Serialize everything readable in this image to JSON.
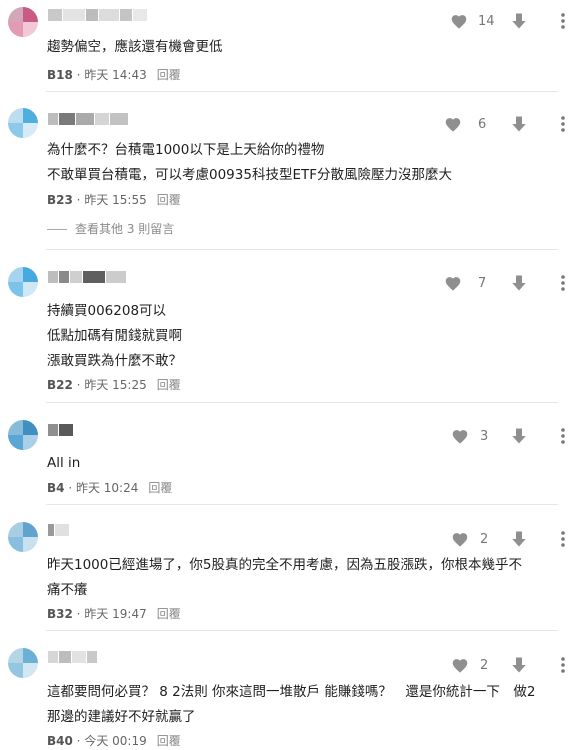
{
  "colors": {
    "heart": "#8f8f8f",
    "text": "#1f1f1f",
    "meta": "#666666"
  },
  "icons": {
    "like": "heart-icon",
    "dislike": "arrow-down-icon",
    "more": "more-vertical-icon"
  },
  "comments": [
    {
      "likes": "14",
      "lines": [
        "趨勢偏空，應該還有機會更低"
      ],
      "floor": "B18",
      "time": "昨天 14:43",
      "reply": "回覆"
    },
    {
      "likes": "6",
      "lines": [
        "為什麼不？台積電1000以下是上天給你的禮物",
        "不敢單買台積電，可以考慮00935科技型ETF分散風險壓力沒那麼大"
      ],
      "floor": "B23",
      "time": "昨天 15:55",
      "reply": "回覆",
      "more_replies": "查看其他 3 則留言"
    },
    {
      "likes": "7",
      "lines": [
        "持續買006208可以",
        "低點加碼有閒錢就買啊",
        "漲敢買跌為什麼不敢？"
      ],
      "floor": "B22",
      "time": "昨天 15:25",
      "reply": "回覆"
    },
    {
      "likes": "3",
      "lines": [
        "All in"
      ],
      "floor": "B4",
      "time": "昨天 10:24",
      "reply": "回覆"
    },
    {
      "likes": "2",
      "lines": [
        "昨天1000已經進場了，你5股真的完全不用考慮，因為五股漲跌，你根本幾乎不",
        "痛不癢"
      ],
      "floor": "B32",
      "time": "昨天 19:47",
      "reply": "回覆"
    },
    {
      "likes": "2",
      "lines": [
        "這都要問何必買？ 8 2法則 你來這問一堆散戶 能賺錢嗎？　還是你統計一下　做2",
        "那邊的建議好不好就贏了"
      ],
      "floor": "B40",
      "time": "今天 00:19",
      "reply": "回覆"
    }
  ]
}
